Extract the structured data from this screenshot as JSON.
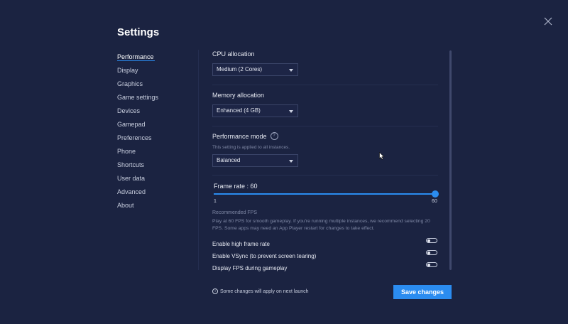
{
  "window": {
    "title": "Settings",
    "close_icon": "close-icon"
  },
  "sidebar": {
    "items": [
      {
        "label": "Performance",
        "active": true
      },
      {
        "label": "Display"
      },
      {
        "label": "Graphics"
      },
      {
        "label": "Game settings"
      },
      {
        "label": "Devices"
      },
      {
        "label": "Gamepad"
      },
      {
        "label": "Preferences"
      },
      {
        "label": "Phone"
      },
      {
        "label": "Shortcuts"
      },
      {
        "label": "User data"
      },
      {
        "label": "Advanced"
      },
      {
        "label": "About"
      }
    ]
  },
  "cpu": {
    "label": "CPU allocation",
    "value": "Medium (2 Cores)"
  },
  "memory": {
    "label": "Memory allocation",
    "value": "Enhanced (4 GB)"
  },
  "performance_mode": {
    "label": "Performance mode",
    "help_icon": "?",
    "subtext": "This setting is applied to all instances.",
    "value": "Balanced"
  },
  "frame_rate": {
    "label": "Frame rate : 60",
    "min": "1",
    "max": "60",
    "value": 60,
    "recommended_title": "Recommended FPS",
    "recommended_text": "Play at 60 FPS for smooth gameplay. If you're running multiple instances, we recommend selecting 20 FPS. Some apps may need an App Player restart for changes to take effect."
  },
  "toggles": [
    {
      "label": "Enable high frame rate",
      "on": false
    },
    {
      "label": "Enable VSync (to prevent screen tearing)",
      "on": false
    },
    {
      "label": "Display FPS during gameplay",
      "on": false
    }
  ],
  "footer": {
    "info_icon": "i",
    "note": "Some changes will apply on next launch",
    "save_label": "Save changes"
  },
  "colors": {
    "background": "#1b2341",
    "accent": "#2b8cf0",
    "muted_text": "#7f88a5"
  }
}
